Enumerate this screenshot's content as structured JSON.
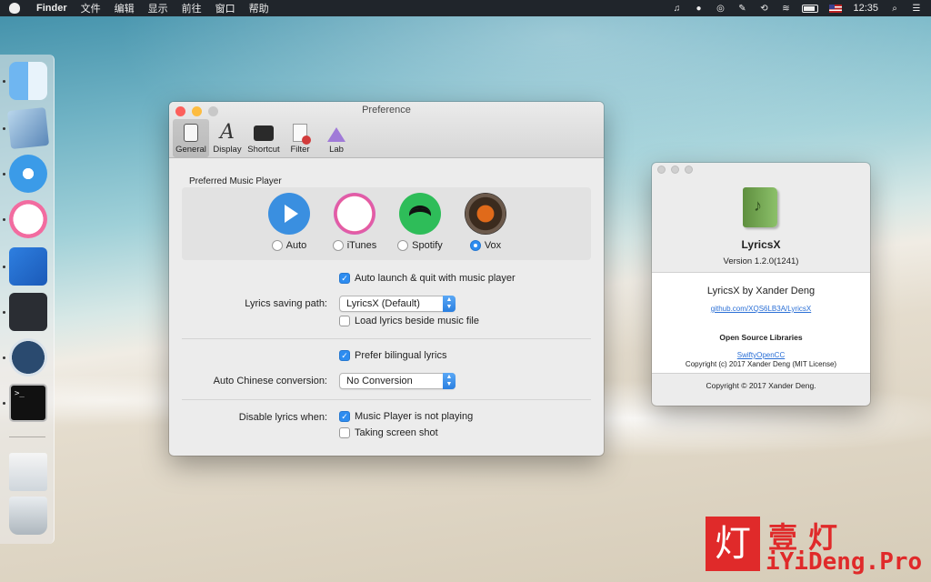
{
  "menubar": {
    "app_name": "Finder",
    "menus": [
      "文件",
      "编辑",
      "显示",
      "前往",
      "窗口",
      "帮助"
    ],
    "clock": "12:35"
  },
  "preference": {
    "title": "Preference",
    "tabs": [
      {
        "label": "General",
        "icon": "general-icon",
        "active": true
      },
      {
        "label": "Display",
        "icon": "display-icon"
      },
      {
        "label": "Shortcut",
        "icon": "shortcut-icon"
      },
      {
        "label": "Filter",
        "icon": "filter-icon"
      },
      {
        "label": "Lab",
        "icon": "lab-icon"
      }
    ],
    "preferred_player_label": "Preferred Music Player",
    "players": [
      {
        "label": "Auto",
        "selected": false
      },
      {
        "label": "iTunes",
        "selected": false
      },
      {
        "label": "Spotify",
        "selected": false
      },
      {
        "label": "Vox",
        "selected": true
      }
    ],
    "auto_launch_label": "Auto launch & quit with music player",
    "auto_launch_checked": true,
    "saving_path_label": "Lyrics saving path:",
    "saving_path_value": "LyricsX (Default)",
    "load_beside_label": "Load lyrics beside music file",
    "load_beside_checked": false,
    "prefer_bilingual_label": "Prefer bilingual lyrics",
    "prefer_bilingual_checked": true,
    "chinese_conversion_label": "Auto Chinese conversion:",
    "chinese_conversion_value": "No Conversion",
    "disable_when_label": "Disable lyrics when:",
    "not_playing_label": "Music Player is not playing",
    "not_playing_checked": true,
    "screenshot_label": "Taking screen shot",
    "screenshot_checked": false
  },
  "about": {
    "app_name": "LyricsX",
    "version": "Version 1.2.0(1241)",
    "author": "LyricsX by Xander Deng",
    "repo_link": "github.com/XQS6LB3A/LyricsX",
    "libraries_heading": "Open Source Libraries",
    "library_link": "SwiftyOpenCC",
    "library_license": "Copyright (c) 2017 Xander Deng (MIT License)",
    "footer": "Copyright © 2017 Xander Deng."
  },
  "watermark": {
    "stamp": "灯",
    "title": "壹灯",
    "site": "iYiDeng.Pro"
  },
  "colors": {
    "accent": "#2d8cf0",
    "close": "#fc605c",
    "minimize": "#fdbc40",
    "zoom": "#c8c8c8",
    "watermark": "#e02a2a"
  }
}
